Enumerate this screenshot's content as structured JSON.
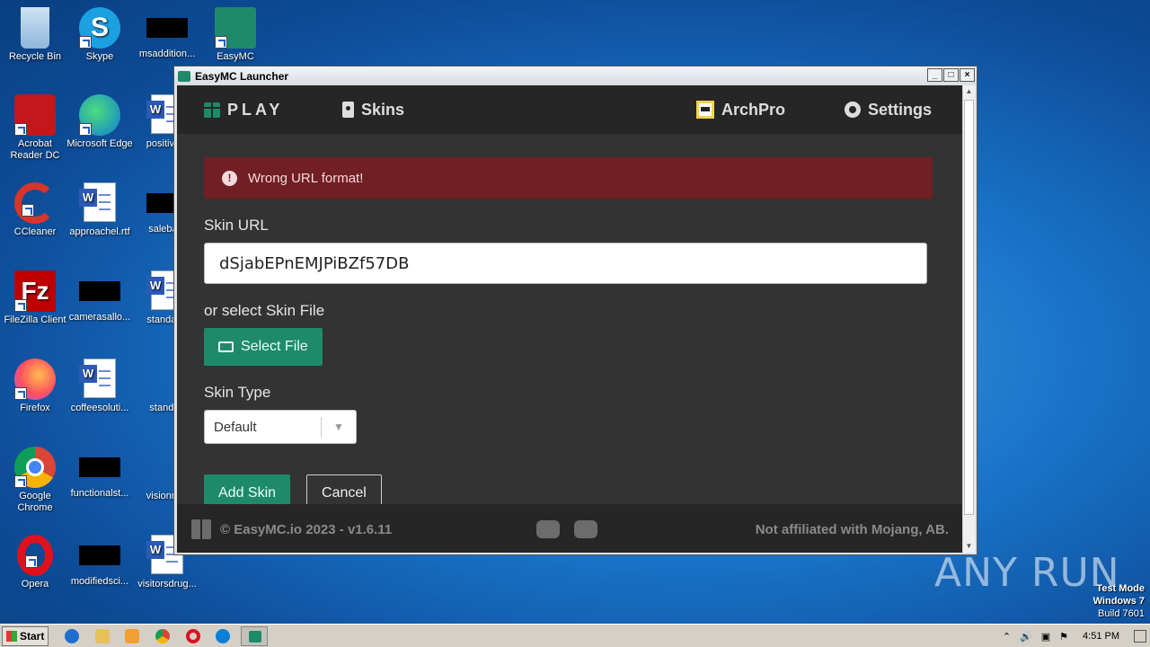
{
  "desktop": {
    "icons": [
      {
        "label": "Recycle Bin"
      },
      {
        "label": "Skype"
      },
      {
        "label": "msaddition..."
      },
      {
        "label": "EasyMC"
      },
      {
        "label": "Acrobat Reader DC"
      },
      {
        "label": "Microsoft Edge"
      },
      {
        "label": "positive..."
      },
      {
        "label": "CCleaner"
      },
      {
        "label": "approachel.rtf"
      },
      {
        "label": "saleba..."
      },
      {
        "label": "FileZilla Client"
      },
      {
        "label": "camerasallo..."
      },
      {
        "label": "standar..."
      },
      {
        "label": "Firefox"
      },
      {
        "label": "coffeesoluti..."
      },
      {
        "label": "standf..."
      },
      {
        "label": "Google Chrome"
      },
      {
        "label": "functionalst..."
      },
      {
        "label": "visionm..."
      },
      {
        "label": "Opera"
      },
      {
        "label": "modifiedsci..."
      },
      {
        "label": "visitorsdrug..."
      }
    ]
  },
  "window": {
    "title": "EasyMC Launcher",
    "buttons": {
      "minimize": "_",
      "maximize": "□",
      "close": "×"
    }
  },
  "app": {
    "nav": {
      "play": "PLAY",
      "skins": "Skins",
      "user": "ArchPro",
      "settings": "Settings"
    },
    "alert": {
      "icon": "!",
      "message": "Wrong URL format!"
    },
    "skin_url_label": "Skin URL",
    "skin_url_value": "dSjabEPnEMJPiBZf57DB",
    "or_select_label": "or select Skin File",
    "select_file_button": "Select File",
    "skin_type_label": "Skin Type",
    "skin_type_value": "Default",
    "add_skin_button": "Add Skin",
    "cancel_button": "Cancel",
    "footer": {
      "copyright": "© EasyMC.io 2023 - v1.6.11",
      "disclaimer": "Not affiliated with Mojang, AB."
    }
  },
  "taskbar": {
    "start": "Start",
    "clock": "4:51 PM",
    "watermark": [
      "Test Mode",
      "Windows 7",
      "Build 7601"
    ]
  },
  "brand_watermark": "ANY RUN",
  "colors": {
    "accent": "#1f8a6a",
    "alert_bg": "#711e24",
    "app_bg": "#333333",
    "nav_bg": "#262626"
  }
}
